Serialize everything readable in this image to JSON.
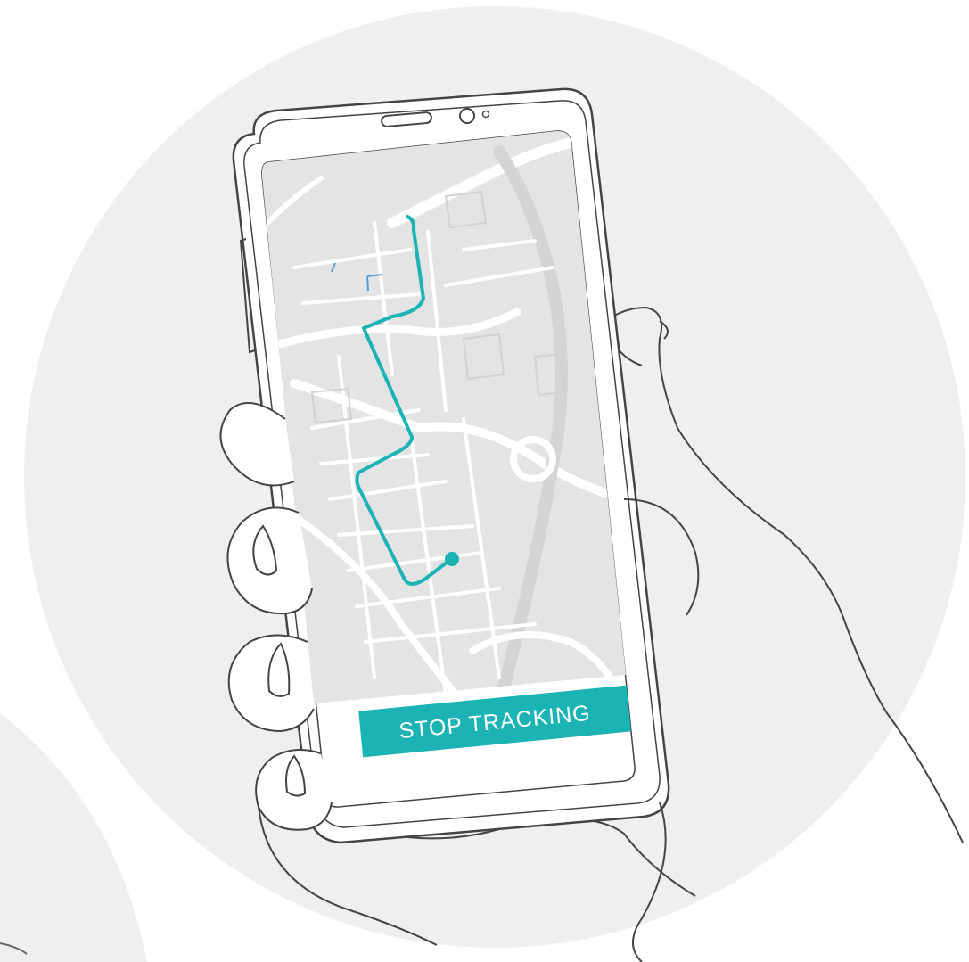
{
  "illustration": {
    "button": {
      "label": "STOP TRACKING",
      "color": "#1bb3b4"
    },
    "route": {
      "color": "#1bb3b4",
      "end_marker": "location-dot"
    },
    "colors": {
      "background_circle": "#efefef",
      "map_background": "#e4e4e4",
      "map_streets": "#ffffff",
      "outline": "#444444"
    }
  }
}
